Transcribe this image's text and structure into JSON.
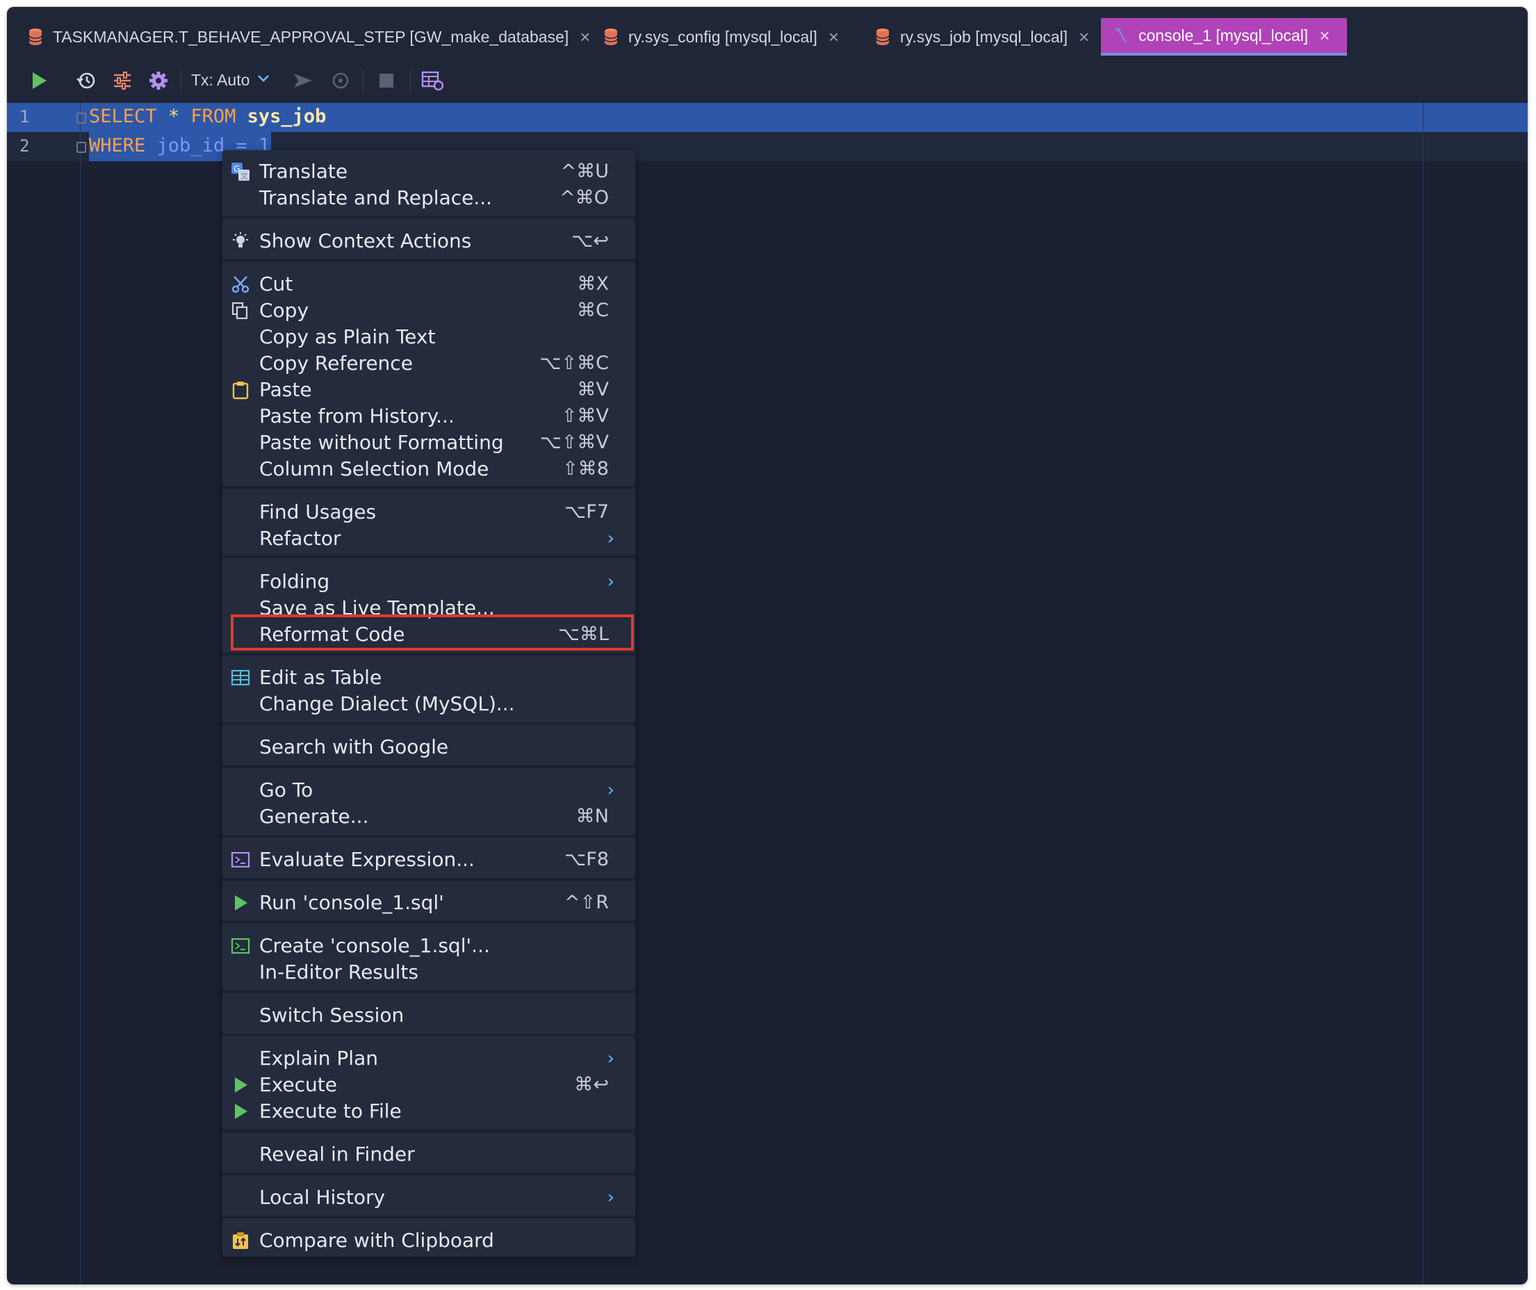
{
  "tabs": [
    {
      "label": "TASKMANAGER.T_BEHAVE_APPROVAL_STEP [GW_make_database]",
      "icon": "database-icon",
      "active": false
    },
    {
      "label": "ry.sys_config [mysql_local]",
      "icon": "database-icon",
      "active": false
    },
    {
      "label": "ry.sys_job [mysql_local]",
      "icon": "database-icon",
      "active": false
    },
    {
      "label": "console_1 [mysql_local]",
      "icon": "console-icon",
      "active": true
    }
  ],
  "toolbar": {
    "tx_label": "Tx: Auto"
  },
  "editor": {
    "lines": [
      {
        "number": "1",
        "parts": [
          "SELECT",
          "*",
          "FROM",
          "sys_job"
        ]
      },
      {
        "number": "2",
        "parts": [
          "WHERE",
          "job_id",
          "=",
          "1"
        ]
      }
    ]
  },
  "menu": {
    "items": [
      {
        "label": "Translate",
        "shortcut": "^⌘U",
        "icon": "translate-icon"
      },
      {
        "label": "Translate and Replace...",
        "shortcut": "^⌘O"
      },
      {
        "label": "Show Context Actions",
        "shortcut": "⌥↩",
        "icon": "lightbulb-icon"
      },
      {
        "label": "Cut",
        "shortcut": "⌘X",
        "icon": "scissors-icon"
      },
      {
        "label": "Copy",
        "shortcut": "⌘C",
        "icon": "copy-icon"
      },
      {
        "label": "Copy as Plain Text",
        "shortcut": ""
      },
      {
        "label": "Copy Reference",
        "shortcut": "⌥⇧⌘C"
      },
      {
        "label": "Paste",
        "shortcut": "⌘V",
        "icon": "clipboard-icon"
      },
      {
        "label": "Paste from History...",
        "shortcut": "⇧⌘V"
      },
      {
        "label": "Paste without Formatting",
        "shortcut": "⌥⇧⌘V"
      },
      {
        "label": "Column Selection Mode",
        "shortcut": "⇧⌘8"
      },
      {
        "label": "Find Usages",
        "shortcut": "⌥F7"
      },
      {
        "label": "Refactor",
        "submenu": true
      },
      {
        "label": "Folding",
        "submenu": true
      },
      {
        "label": "Save as Live Template...",
        "shortcut": ""
      },
      {
        "label": "Reformat Code",
        "shortcut": "⌥⌘L",
        "highlighted": true
      },
      {
        "label": "Edit as Table",
        "shortcut": "",
        "icon": "table-icon"
      },
      {
        "label": "Change Dialect (MySQL)...",
        "shortcut": ""
      },
      {
        "label": "Search with Google",
        "shortcut": ""
      },
      {
        "label": "Go To",
        "submenu": true
      },
      {
        "label": "Generate...",
        "shortcut": "⌘N"
      },
      {
        "label": "Evaluate Expression...",
        "shortcut": "⌥F8",
        "icon": "evaluate-icon"
      },
      {
        "label": "Run 'console_1.sql'",
        "shortcut": "^⇧R",
        "icon": "run-icon"
      },
      {
        "label": "Create 'console_1.sql'...",
        "shortcut": "",
        "icon": "terminal-icon"
      },
      {
        "label": "In-Editor Results",
        "shortcut": ""
      },
      {
        "label": "Switch Session",
        "shortcut": ""
      },
      {
        "label": "Explain Plan",
        "submenu": true
      },
      {
        "label": "Execute",
        "shortcut": "⌘↩",
        "icon": "run-icon"
      },
      {
        "label": "Execute to File",
        "shortcut": "",
        "icon": "run-icon"
      },
      {
        "label": "Reveal in Finder",
        "shortcut": ""
      },
      {
        "label": "Local History",
        "submenu": true
      },
      {
        "label": "Compare with Clipboard",
        "shortcut": "",
        "icon": "compare-clipboard-icon"
      }
    ],
    "submenu_glyph": "›"
  },
  "colors": {
    "active_tab": "#b143b8",
    "selection": "#2d57a8",
    "highlight_box": "#e03a2b",
    "keyword": "#ff9f4a"
  }
}
